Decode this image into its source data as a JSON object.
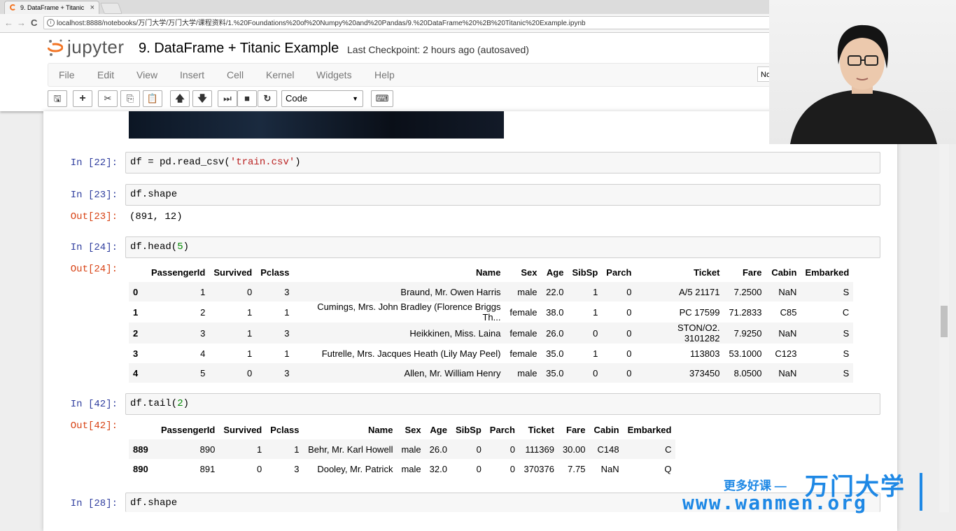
{
  "browser": {
    "tab_title": "9. DataFrame + Titanic",
    "tab_close": "×",
    "url": "localhost:8888/notebooks/万门大学/万门大学/课程资料/1.%20Foundations%20of%20Numpy%20and%20Pandas/9.%20DataFrame%20%2B%20Titanic%20Example.ipynb",
    "back_glyph": "←",
    "forward_glyph": "→",
    "reload_glyph": "C",
    "url_icon_glyph": "i"
  },
  "header": {
    "logo_text": "jupyter",
    "notebook_title": "9. DataFrame + Titanic Example",
    "checkpoint": "Last Checkpoint: 2 hours ago (autosaved)",
    "kernel_indicator": "No"
  },
  "menu": {
    "items": [
      "File",
      "Edit",
      "View",
      "Insert",
      "Cell",
      "Kernel",
      "Widgets",
      "Help"
    ]
  },
  "toolbar": {
    "cell_type": "Code",
    "icons": [
      "save-icon",
      "plus-icon",
      "cut-icon",
      "copy-icon",
      "paste-icon",
      "arrow-up-icon",
      "arrow-down-icon",
      "run-icon",
      "stop-icon",
      "restart-icon",
      "keyboard-icon"
    ],
    "glyphs": {
      "save": "🖫",
      "add": "+",
      "cut": "✂",
      "copy": "⎘",
      "paste": "📋",
      "up": "🡅",
      "down": "🡇",
      "run": "⏭",
      "stop": "■",
      "restart": "↻",
      "keyboard": "⌨",
      "caret": "▼"
    }
  },
  "cells": {
    "c22": {
      "prompt": "In  [22]:",
      "code_pre": "df = pd.read_csv(",
      "code_str": "'train.csv'",
      "code_post": ")"
    },
    "c23": {
      "prompt": "In  [23]:",
      "code": "df.shape",
      "out_prompt": "Out[23]:",
      "output": "(891, 12)"
    },
    "c24": {
      "prompt": "In  [24]:",
      "code_pre": "df.head(",
      "code_num": "5",
      "code_post": ")",
      "out_prompt": "Out[24]:",
      "columns": [
        "",
        "PassengerId",
        "Survived",
        "Pclass",
        "Name",
        "Sex",
        "Age",
        "SibSp",
        "Parch",
        "Ticket",
        "Fare",
        "Cabin",
        "Embarked"
      ],
      "rows": [
        [
          "0",
          "1",
          "0",
          "3",
          "Braund, Mr. Owen Harris",
          "male",
          "22.0",
          "1",
          "0",
          "A/5 21171",
          "7.2500",
          "NaN",
          "S"
        ],
        [
          "1",
          "2",
          "1",
          "1",
          "Cumings, Mrs. John Bradley (Florence Briggs Th...",
          "female",
          "38.0",
          "1",
          "0",
          "PC 17599",
          "71.2833",
          "C85",
          "C"
        ],
        [
          "2",
          "3",
          "1",
          "3",
          "Heikkinen, Miss. Laina",
          "female",
          "26.0",
          "0",
          "0",
          "STON/O2. 3101282",
          "7.9250",
          "NaN",
          "S"
        ],
        [
          "3",
          "4",
          "1",
          "1",
          "Futrelle, Mrs. Jacques Heath (Lily May Peel)",
          "female",
          "35.0",
          "1",
          "0",
          "113803",
          "53.1000",
          "C123",
          "S"
        ],
        [
          "4",
          "5",
          "0",
          "3",
          "Allen, Mr. William Henry",
          "male",
          "35.0",
          "0",
          "0",
          "373450",
          "8.0500",
          "NaN",
          "S"
        ]
      ]
    },
    "c42": {
      "prompt": "In  [42]:",
      "code_pre": "df.tail(",
      "code_num": "2",
      "code_post": ")",
      "out_prompt": "Out[42]:",
      "columns": [
        "",
        "PassengerId",
        "Survived",
        "Pclass",
        "Name",
        "Sex",
        "Age",
        "SibSp",
        "Parch",
        "Ticket",
        "Fare",
        "Cabin",
        "Embarked"
      ],
      "rows": [
        [
          "889",
          "890",
          "1",
          "1",
          "Behr, Mr. Karl Howell",
          "male",
          "26.0",
          "0",
          "0",
          "111369",
          "30.00",
          "C148",
          "C"
        ],
        [
          "890",
          "891",
          "0",
          "3",
          "Dooley, Mr. Patrick",
          "male",
          "32.0",
          "0",
          "0",
          "370376",
          "7.75",
          "NaN",
          "Q"
        ]
      ]
    },
    "c28": {
      "prompt": "In  [28]:",
      "code": "df.shape"
    }
  },
  "watermark": {
    "cn_text": "更多好课 —",
    "logo_text": "万门大学",
    "url": "www.wanmen.org"
  },
  "colors": {
    "prompt_in": "#303f9f",
    "prompt_out": "#d84315",
    "string": "#ba2121",
    "number": "#008800",
    "watermark": "#1e88e5",
    "jupyter_orange": "#f37524"
  }
}
